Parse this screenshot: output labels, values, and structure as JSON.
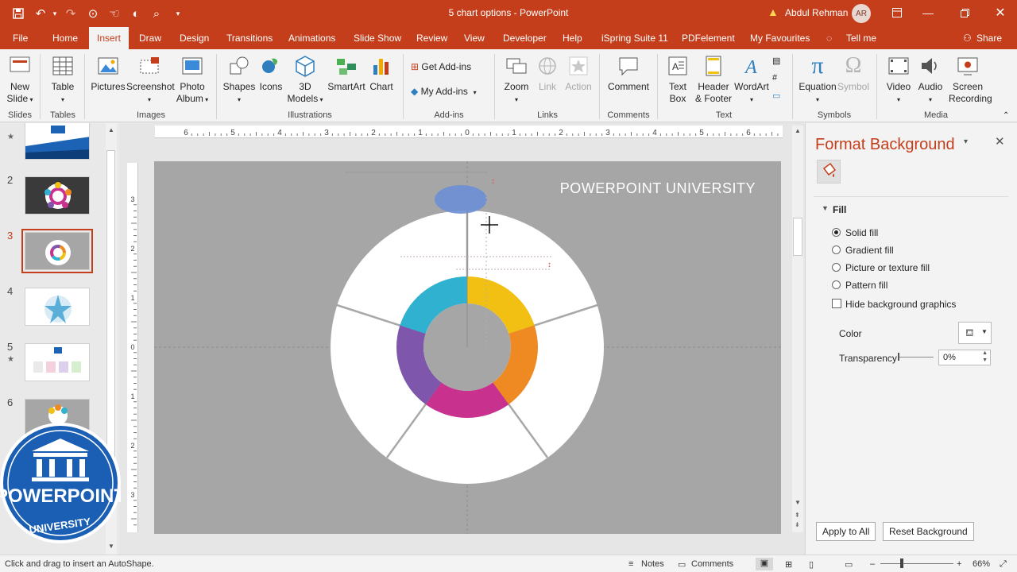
{
  "title_bar": {
    "document_title": "5 chart options  -  PowerPoint",
    "user_name": "Abdul Rehman",
    "user_initials": "AR",
    "qat_icons": [
      "save-icon",
      "undo-icon",
      "redo-icon",
      "format-painter-icon",
      "touch-mode-icon",
      "print-preview-icon",
      "customize-qat-icon"
    ],
    "window_icons": [
      "ribbon-display-icon",
      "minimize-icon",
      "restore-icon",
      "close-icon"
    ]
  },
  "tabs": [
    {
      "label": "File"
    },
    {
      "label": "Home"
    },
    {
      "label": "Insert",
      "active": true
    },
    {
      "label": "Draw"
    },
    {
      "label": "Design"
    },
    {
      "label": "Transitions"
    },
    {
      "label": "Animations"
    },
    {
      "label": "Slide Show"
    },
    {
      "label": "Review"
    },
    {
      "label": "View"
    },
    {
      "label": "Developer"
    },
    {
      "label": "Help"
    },
    {
      "label": "iSpring Suite 11"
    },
    {
      "label": "PDFelement"
    },
    {
      "label": "My Favourites"
    }
  ],
  "tell_me": "Tell me",
  "share": "Share",
  "ribbon": {
    "new_slide": [
      "New",
      "Slide"
    ],
    "table": "Table",
    "pictures": "Pictures",
    "screenshot": "Screenshot",
    "photo_album": [
      "Photo",
      "Album"
    ],
    "shapes": "Shapes",
    "icons": "Icons",
    "models_3d": [
      "3D",
      "Models"
    ],
    "smartart": "SmartArt",
    "chart": "Chart",
    "get_addins": "Get Add-ins",
    "my_addins": "My Add-ins",
    "zoom": "Zoom",
    "link": "Link",
    "action": "Action",
    "comment": "Comment",
    "text_box": [
      "Text",
      "Box"
    ],
    "header_footer": [
      "Header",
      "& Footer"
    ],
    "wordart": "WordArt",
    "equation": "Equation",
    "symbol": "Symbol",
    "video": "Video",
    "audio": "Audio",
    "screen_recording": [
      "Screen",
      "Recording"
    ],
    "groups": {
      "slides": "Slides",
      "tables": "Tables",
      "images": "Images",
      "illustrations": "Illustrations",
      "addins": "Add-ins",
      "links": "Links",
      "comments": "Comments",
      "text": "Text",
      "symbols": "Symbols",
      "media": "Media"
    }
  },
  "slide_panel": {
    "numbers": [
      "2",
      "3",
      "4",
      "5",
      "6"
    ],
    "selected": "3"
  },
  "slide": {
    "watermark": "POWERPOINT UNIVERSITY",
    "background_color": "#a6a6a6",
    "ring_colors": [
      "#f2c012",
      "#ef8a22",
      "#c8318e",
      "#7e56ab",
      "#2fb1cf"
    ]
  },
  "ruler": {
    "h_labels": [
      "6",
      "5",
      "4",
      "3",
      "2",
      "1",
      "0",
      "1",
      "2",
      "3",
      "4",
      "5",
      "6"
    ],
    "v_labels": [
      "3",
      "2",
      "1",
      "0",
      "1",
      "2",
      "3"
    ]
  },
  "format_pane": {
    "title": "Format Background",
    "section": "Fill",
    "options": [
      "Solid fill",
      "Gradient fill",
      "Picture or texture fill",
      "Pattern fill"
    ],
    "selected_option": "Solid fill",
    "hide_graphics": "Hide background graphics",
    "color_label": "Color",
    "transparency_label": "Transparency",
    "transparency_value": "0%",
    "apply_all": "Apply to All",
    "reset": "Reset Background"
  },
  "logo": {
    "line1": "POWERPOINT",
    "line2": "UNIVERSITY"
  },
  "status_bar": {
    "message": "Click and drag to insert an AutoShape.",
    "notes": "Notes",
    "comments": "Comments",
    "zoom": "66%"
  }
}
